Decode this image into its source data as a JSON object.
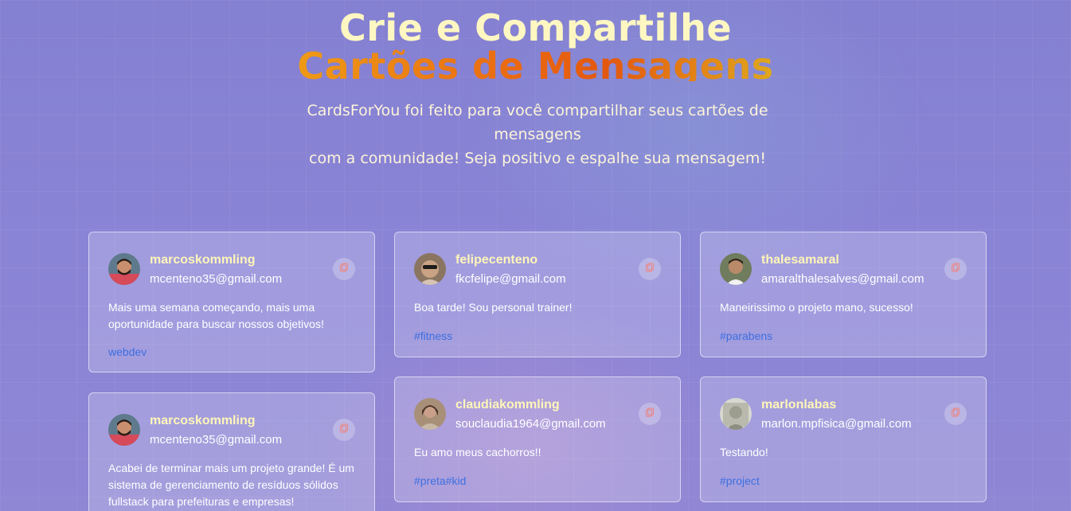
{
  "header": {
    "title_line1": "Crie e Compartilhe",
    "title_line2": "Cartões de Mensagens",
    "subtitle_line1": "CardsForYou foi feito para você compartilhar seus cartões de mensagens",
    "subtitle_line2": "com a comunidade! Seja positivo e espalhe sua mensagem!"
  },
  "cards": [
    {
      "username": "marcoskommling",
      "email": "mcenteno35@gmail.com",
      "message": "Mais uma semana começando, mais uma oportunidade para buscar nossos objetivos!",
      "tags": "webdev"
    },
    {
      "username": "felipecenteno",
      "email": "fkcfelipe@gmail.com",
      "message": "Boa tarde! Sou personal trainer!",
      "tags": "#fitness"
    },
    {
      "username": "thalesamaral",
      "email": "amaralthalesalves@gmail.com",
      "message": "Maneirissimo o projeto mano, sucesso!",
      "tags": "#parabens"
    },
    {
      "username": "marcoskommling",
      "email": "mcenteno35@gmail.com",
      "message": "Acabei de terminar mais um projeto grande! É um sistema de gerenciamento de resíduos sólidos fullstack para prefeituras e empresas!",
      "tags": ""
    },
    {
      "username": "claudiakommling",
      "email": "souclaudia1964@gmail.com",
      "message": "Eu amo meus cachorros!!",
      "tags": "#preta#kid"
    },
    {
      "username": "marlonlabas",
      "email": "marlon.mpfisica@gmail.com",
      "message": "Testando!",
      "tags": "#project"
    }
  ],
  "icons": {
    "copy": "copy-icon"
  },
  "colors": {
    "title": "#fff7c2",
    "title_gradient_start": "#ee9a16",
    "title_gradient_mid": "#e3580f",
    "username": "#fff6b8",
    "tag": "#3d6fe0",
    "copy_icon": "#e88a8a"
  }
}
